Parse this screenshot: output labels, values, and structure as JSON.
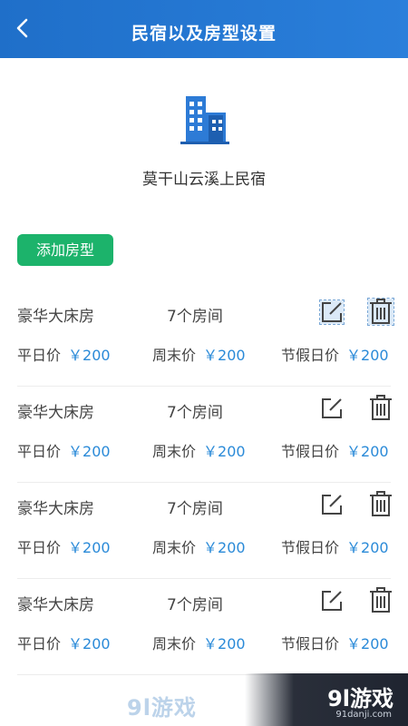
{
  "header": {
    "title": "民宿以及房型设置"
  },
  "inn": {
    "name": "莫干山云溪上民宿"
  },
  "actions": {
    "add_room_type": "添加房型"
  },
  "rooms": [
    {
      "name": "豪华大床房",
      "count": "7个房间",
      "weekday_label": "平日价",
      "weekday_price": "￥200",
      "weekend_label": "周末价",
      "weekend_price": "￥200",
      "holiday_label": "节假日价",
      "holiday_price": "￥200"
    },
    {
      "name": "豪华大床房",
      "count": "7个房间",
      "weekday_label": "平日价",
      "weekday_price": "￥200",
      "weekend_label": "周末价",
      "weekend_price": "￥200",
      "holiday_label": "节假日价",
      "holiday_price": "￥200"
    },
    {
      "name": "豪华大床房",
      "count": "7个房间",
      "weekday_label": "平日价",
      "weekday_price": "￥200",
      "weekend_label": "周末价",
      "weekend_price": "￥200",
      "holiday_label": "节假日价",
      "holiday_price": "￥200"
    },
    {
      "name": "豪华大床房",
      "count": "7个房间",
      "weekday_label": "平日价",
      "weekday_price": "￥200",
      "weekend_label": "周末价",
      "weekend_price": "￥200",
      "holiday_label": "节假日价",
      "holiday_price": "￥200"
    }
  ],
  "watermark": {
    "left": "9l游戏",
    "logo": "9l游戏",
    "url": "91danji.com"
  },
  "colors": {
    "header": "#2a7fdb",
    "add_button": "#1cb36b",
    "price": "#2a8ad8"
  },
  "icons": {
    "back": "back-arrow-icon",
    "building": "building-icon",
    "edit": "edit-icon",
    "delete": "trash-icon"
  }
}
